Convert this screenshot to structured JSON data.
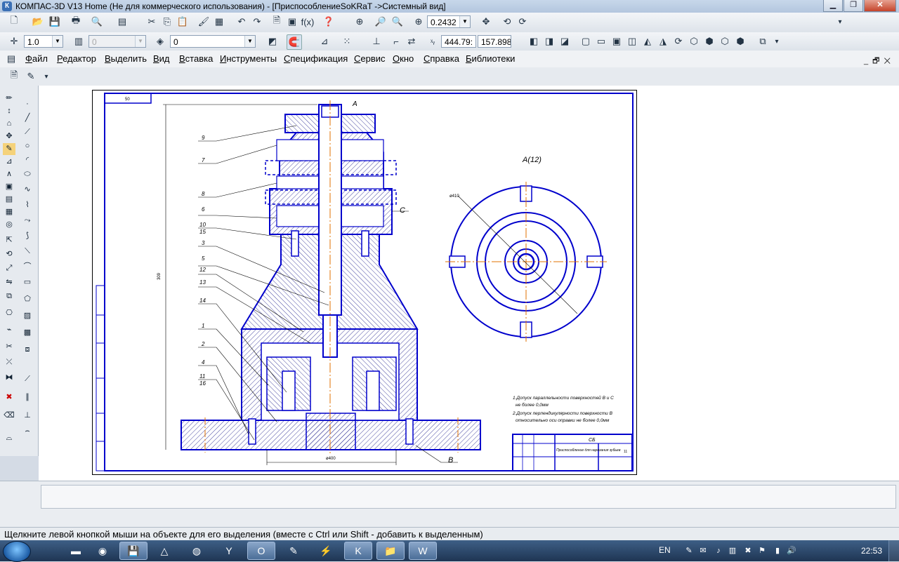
{
  "window": {
    "title": "КОМПАС-3D V13 Home (Не для коммерческого использования) - [ПриспособлениеSoKRaT ->Системный вид]",
    "app_icon": "К"
  },
  "toolbar1": {
    "zoom_value": "0.2432"
  },
  "toolbar2": {
    "step_value": "1.0",
    "layer_value": "0",
    "style_value": "0",
    "coord_x": "444.79:",
    "coord_y": "157.898"
  },
  "menu": {
    "items": [
      "Файл",
      "Редактор",
      "Выделить",
      "Вид",
      "Вставка",
      "Инструменты",
      "Спецификация",
      "Сервис",
      "Окно",
      "Справка",
      "Библиотеки"
    ]
  },
  "drawing": {
    "section_label": "A(12)",
    "arrow_label": "A",
    "callouts": [
      "9",
      "7",
      "8",
      "6",
      "10",
      "15",
      "3",
      "5",
      "12",
      "13",
      "14",
      "1",
      "2",
      "4",
      "11",
      "16"
    ],
    "label_c": "C",
    "label_b": "B",
    "dim_bottom": "ø400",
    "dim_left": "309",
    "dim_circle": "ø410",
    "dim_top": "50",
    "note_1a": "1.Допуск параллельности поверхностей В и С",
    "note_1b": "не более 0,0мм",
    "note_2a": "2.Допуск перпендикулярности поверхности В",
    "note_2b": "относительно оси оправки не более 0,0мм",
    "stamp_code": "СБ",
    "stamp_title": "Приспособление для нарезания зубьев",
    "stamp_sheet": "11"
  },
  "status": {
    "hint": "Щелкните левой кнопкой мыши на объекте для его выделения (вместе с Ctrl или Shift - добавить к выделенным)"
  },
  "taskbar": {
    "lang": "EN",
    "clock": "22:53"
  },
  "colors": {
    "drawing_line": "#0000cc",
    "hatch": "#1a1a8a",
    "axis": "#e07000"
  }
}
